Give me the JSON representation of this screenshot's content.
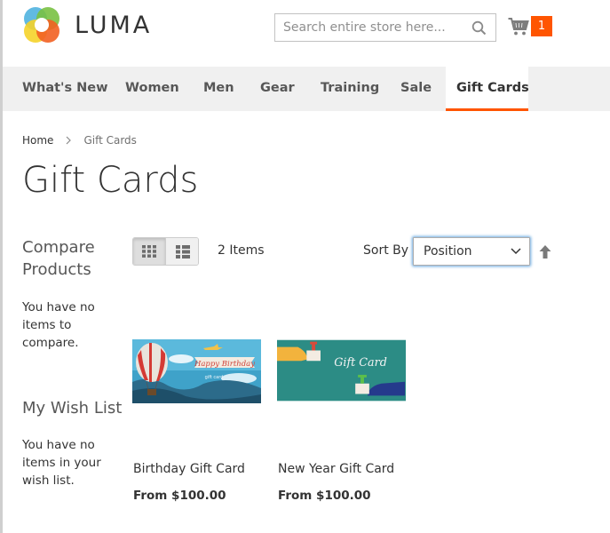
{
  "header": {
    "logo_text": "LUMA",
    "search_placeholder": "Search entire store here...",
    "cart_count": "1"
  },
  "nav": {
    "items": [
      {
        "label": "What's New"
      },
      {
        "label": "Women"
      },
      {
        "label": "Men"
      },
      {
        "label": "Gear"
      },
      {
        "label": "Training"
      },
      {
        "label": "Sale"
      },
      {
        "label": "Gift Cards",
        "active": true
      }
    ]
  },
  "breadcrumbs": {
    "home": "Home",
    "current": "Gift Cards"
  },
  "page_title": "Gift Cards",
  "sidebar": {
    "compare_title": "Compare Products",
    "compare_empty": "You have no items to compare.",
    "wishlist_title": "My Wish List",
    "wishlist_empty": "You have no items in your wish list."
  },
  "toolbar": {
    "view_modes": [
      "grid-icon",
      "list-icon"
    ],
    "active_mode": "grid",
    "amount": "2 Items",
    "sort_label": "Sort By",
    "sort_value": "Position"
  },
  "products": [
    {
      "name": "Birthday Gift Card",
      "price": "From $100.00",
      "image_text": "Happy Birthday",
      "image_subtext": "gift card"
    },
    {
      "name": "New Year Gift Card",
      "price": "From $100.00",
      "image_text": "Gift Card"
    }
  ],
  "colors": {
    "accent": "#ff5501",
    "nav_bg": "#f0f0f0",
    "text": "#333333",
    "focus_ring": "#68a8e0"
  }
}
